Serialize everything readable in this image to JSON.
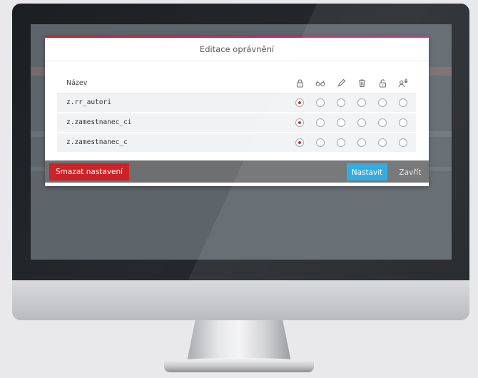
{
  "dialog": {
    "title": "Editace oprávnění",
    "accent_colors": [
      "#c2272d",
      "#a83a8a"
    ]
  },
  "table": {
    "name_header": "Název",
    "permission_columns": [
      {
        "icon": "lock-icon"
      },
      {
        "icon": "glasses-icon"
      },
      {
        "icon": "pencil-icon"
      },
      {
        "icon": "trash-icon"
      },
      {
        "icon": "unlock-icon"
      },
      {
        "icon": "user-lock-icon"
      }
    ],
    "rows": [
      {
        "name": "z.rr_autori",
        "selected_column": 0
      },
      {
        "name": "z.zamestnanec_ci",
        "selected_column": 0
      },
      {
        "name": "z.zamestnanec_c",
        "selected_column": 0
      }
    ]
  },
  "footer": {
    "delete_label": "Smazat nastavení",
    "set_label": "Nastavit",
    "close_label": "Zavřít",
    "delete_color": "#cd2227",
    "set_color": "#26a6de"
  }
}
